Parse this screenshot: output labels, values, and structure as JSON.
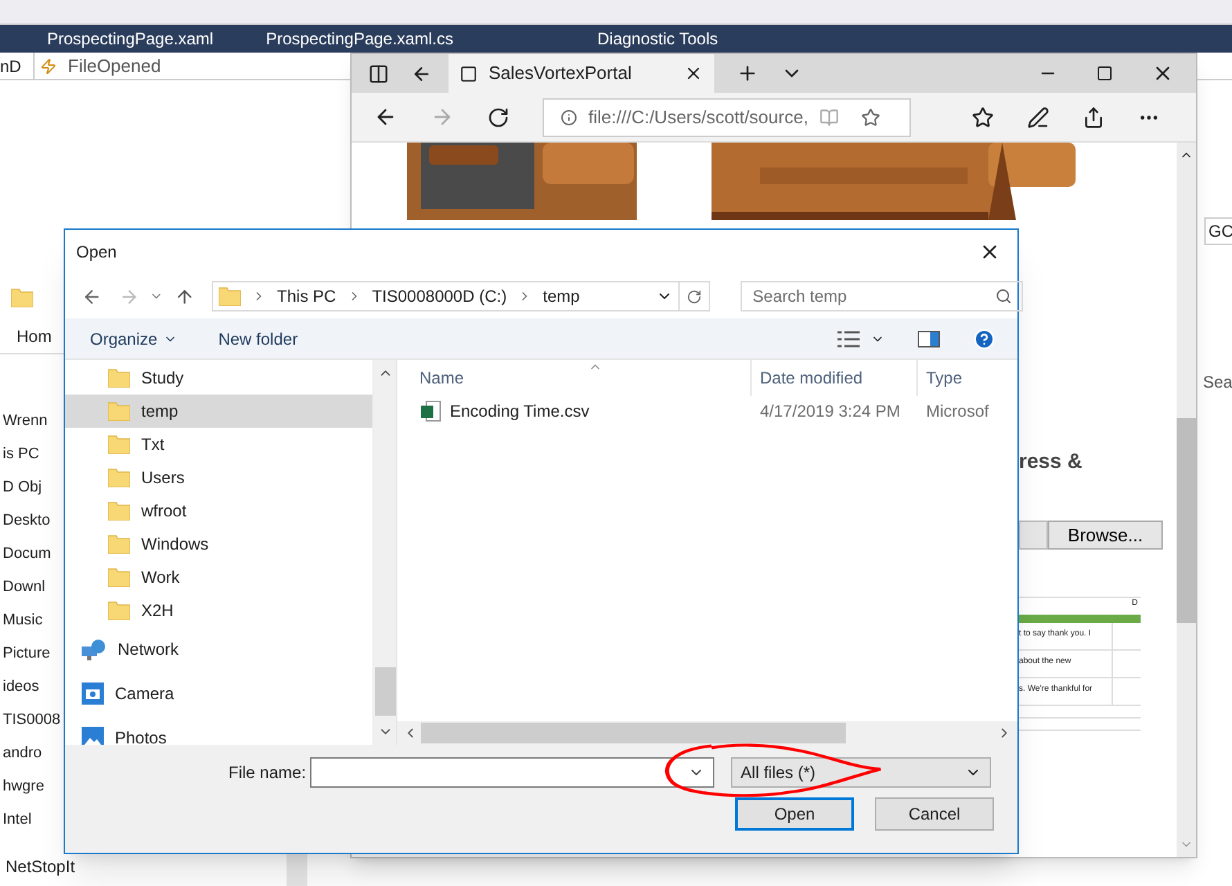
{
  "ide": {
    "tabs": [
      {
        "label": "ProspectingPage.xaml",
        "selected": false
      },
      {
        "label": "ProspectingPage.xaml.cs",
        "selected": false
      },
      {
        "label": "Diagnostic Tools",
        "selected": false
      }
    ],
    "scope_combo": "nD",
    "event_combo": "FileOpened",
    "side_texts": [
      "GC",
      "Sea"
    ]
  },
  "explorer": {
    "ribbon_tab": "Hom",
    "nav_items": [
      "Wrenn",
      "is PC",
      "D Obj",
      "Deskto",
      "Docum",
      "Downl",
      "Music",
      "Picture",
      "ideos",
      "TIS0008",
      "andro",
      "hwgre",
      "Intel"
    ],
    "below_item": "NetStopIt"
  },
  "browser": {
    "tab_title": "SalesVortexPortal",
    "address": "file:///C:/Users/scott/source,",
    "heading_fragment": "ress &",
    "browse_button": "Browse...",
    "table": {
      "column_2": "D",
      "rows": [
        "t to say thank you. I",
        "about the new",
        "s. We're thankful for"
      ]
    }
  },
  "dialog": {
    "title": "Open",
    "breadcrumb": [
      "This PC",
      "TIS0008000D (C:)",
      "temp"
    ],
    "search": {
      "placeholder": "Search temp"
    },
    "toolbar": [
      "Organize",
      "New folder"
    ],
    "nav_items": [
      {
        "kind": "folder",
        "label": "Study",
        "selected": false
      },
      {
        "kind": "folder",
        "label": "temp",
        "selected": true
      },
      {
        "kind": "folder",
        "label": "Txt",
        "selected": false
      },
      {
        "kind": "folder",
        "label": "Users",
        "selected": false
      },
      {
        "kind": "folder",
        "label": "wfroot",
        "selected": false
      },
      {
        "kind": "folder",
        "label": "Windows",
        "selected": false
      },
      {
        "kind": "folder",
        "label": "Work",
        "selected": false
      },
      {
        "kind": "folder",
        "label": "X2H",
        "selected": false
      },
      {
        "kind": "network",
        "label": "Network",
        "selected": false
      },
      {
        "kind": "camera",
        "label": "Camera",
        "selected": false
      },
      {
        "kind": "photos",
        "label": "Photos",
        "selected": false
      }
    ],
    "columns": [
      "Name",
      "Date modified",
      "Type"
    ],
    "files": [
      {
        "name": "Encoding Time.csv",
        "date": "4/17/2019 3:24 PM",
        "type": "Microsof"
      }
    ],
    "file_name_label": "File name:",
    "file_type": "All files (*)",
    "buttons": [
      "Open",
      "Cancel"
    ]
  }
}
